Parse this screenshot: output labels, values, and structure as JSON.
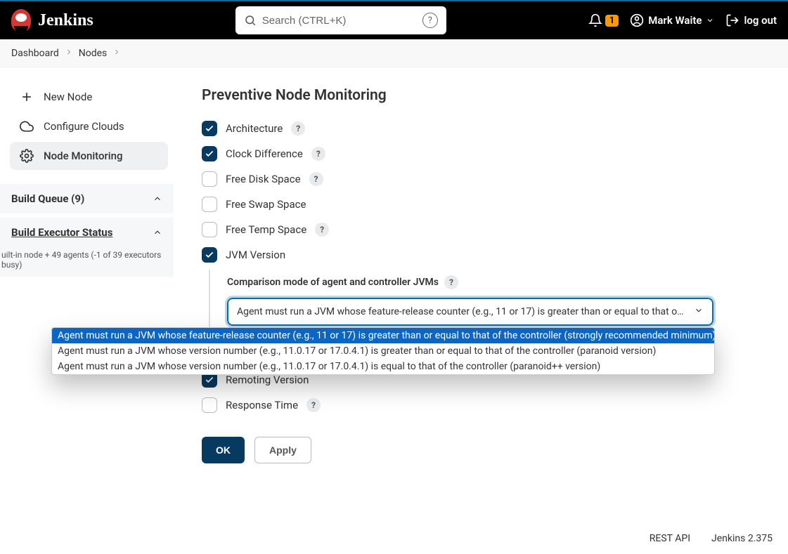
{
  "header": {
    "brand": "Jenkins",
    "search_placeholder": "Search (CTRL+K)",
    "notifications": "1",
    "user": "Mark Waite",
    "logout": "log out"
  },
  "breadcrumb": {
    "items": [
      "Dashboard",
      "Nodes"
    ]
  },
  "sidebar": {
    "items": [
      {
        "label": "New Node",
        "icon": "plus"
      },
      {
        "label": "Configure Clouds",
        "icon": "cloud"
      },
      {
        "label": "Node Monitoring",
        "icon": "gear",
        "active": true
      }
    ],
    "panels": {
      "build_queue": "Build Queue (9)",
      "exec_status": "Build Executor Status",
      "exec_sub": "uilt-in node + 49 agents (-1 of 39 executors busy)"
    }
  },
  "main": {
    "title": "Preventive Node Monitoring",
    "monitors": {
      "architecture": "Architecture",
      "clock_diff": "Clock Difference",
      "free_disk": "Free Disk Space",
      "free_swap": "Free Swap Space",
      "free_temp": "Free Temp Space",
      "jvm_version": "JVM Version",
      "remoting": "Remoting Version",
      "response": "Response Time"
    },
    "jvm": {
      "sublabel": "Comparison mode of agent and controller JVMs",
      "selected": "Agent must run a JVM whose feature-release counter (e.g., 11 or 17) is greater than or equal to that of the con",
      "options": [
        "Agent must run a JVM whose feature-release counter (e.g., 11 or 17) is greater than or equal to that of the controller (strongly recommended minimum)",
        "Agent must run a JVM whose version number (e.g., 11.0.17 or 17.0.4.1) is greater than or equal to that of the controller (paranoid version)",
        "Agent must run a JVM whose version number (e.g., 11.0.17 or 17.0.4.1) is equal to that of the controller (paranoid++ version)"
      ]
    },
    "buttons": {
      "ok": "OK",
      "apply": "Apply"
    }
  },
  "footer": {
    "api": "REST API",
    "version": "Jenkins 2.375"
  }
}
